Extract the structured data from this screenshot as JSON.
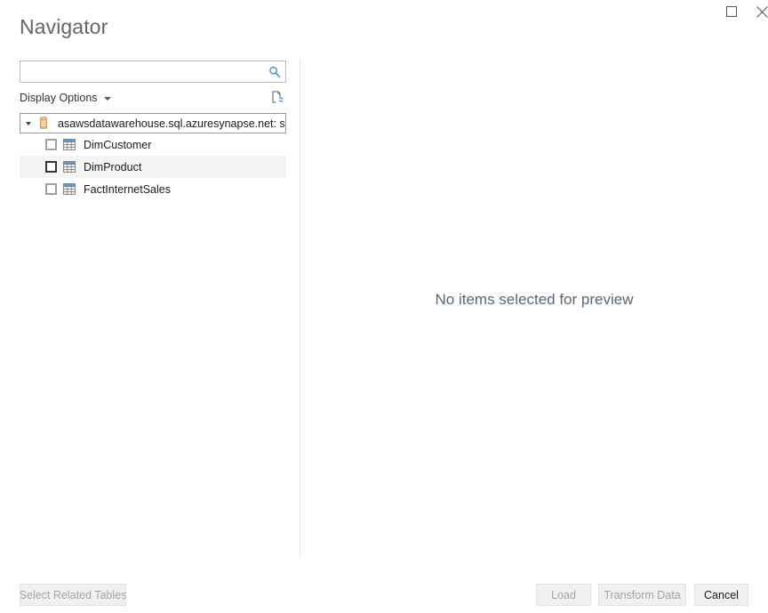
{
  "window": {
    "title": "Navigator",
    "controls": [
      {
        "name": "maximize-button",
        "icon": "maximize-icon"
      },
      {
        "name": "close-button",
        "icon": "close-icon"
      }
    ]
  },
  "search": {
    "value": "",
    "placeholder": "",
    "icon": "search-icon"
  },
  "toolbar": {
    "display_options_label": "Display Options",
    "display_options_caret": "chevron-down-icon",
    "refresh_icon": "refresh-page-icon"
  },
  "tree": {
    "root": {
      "label": "asawsdatawarehouse.sql.azuresynapse.net: sql...",
      "icon": "database-icon",
      "expander": "expander-collapse-icon",
      "expanded": true
    },
    "items": [
      {
        "label": "DimCustomer",
        "icon": "table-icon",
        "checked": false,
        "hovered": false,
        "focused": false
      },
      {
        "label": "DimProduct",
        "icon": "table-icon",
        "checked": false,
        "hovered": true,
        "focused": true
      },
      {
        "label": "FactInternetSales",
        "icon": "table-icon",
        "checked": false,
        "hovered": false,
        "focused": false
      }
    ]
  },
  "preview": {
    "empty_message": "No items selected for preview"
  },
  "footer": {
    "select_related_label": "Select Related Tables",
    "load_label": "Load",
    "transform_label": "Transform Data",
    "cancel_label": "Cancel"
  },
  "colors": {
    "accent_blue": "#4a7ebb",
    "database_orange": "#e8a76a",
    "divider": "#e6e6e6",
    "title_gray": "#656565",
    "disabled_text": "#a6a6a6",
    "hover_row": "#f4f4f4"
  }
}
